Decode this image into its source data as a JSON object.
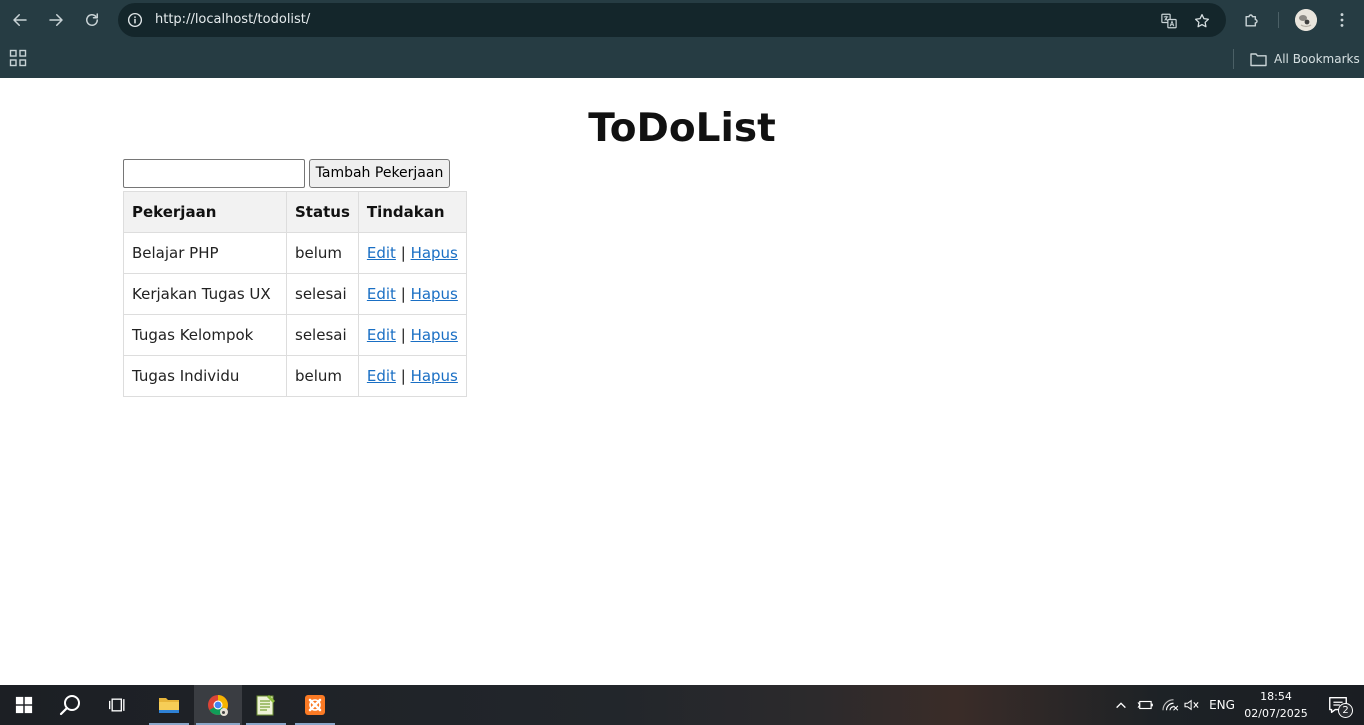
{
  "browser": {
    "url": "http://localhost/todolist/",
    "bookmarks_label": "All Bookmarks"
  },
  "page": {
    "title": "ToDoList",
    "input_value": "",
    "add_button_label": "Tambah Pekerjaan",
    "columns": [
      "Pekerjaan",
      "Status",
      "Tindakan"
    ],
    "rows": [
      {
        "task": "Belajar PHP",
        "status": "belum",
        "edit": "Edit",
        "separator": "|",
        "delete": "Hapus"
      },
      {
        "task": "Kerjakan Tugas UX",
        "status": "selesai",
        "edit": "Edit",
        "separator": "|",
        "delete": "Hapus"
      },
      {
        "task": "Tugas Kelompok",
        "status": "selesai",
        "edit": "Edit",
        "separator": "|",
        "delete": "Hapus"
      },
      {
        "task": "Tugas Individu",
        "status": "belum",
        "edit": "Edit",
        "separator": "|",
        "delete": "Hapus"
      }
    ]
  },
  "taskbar": {
    "language": "ENG",
    "time": "18:54",
    "date": "02/07/2025",
    "notification_count": "2"
  },
  "colors": {
    "chrome_bg": "#263c43",
    "omnibox_bg": "#14262b",
    "link": "#1a6fc4",
    "table_header_bg": "#f2f2f2"
  }
}
